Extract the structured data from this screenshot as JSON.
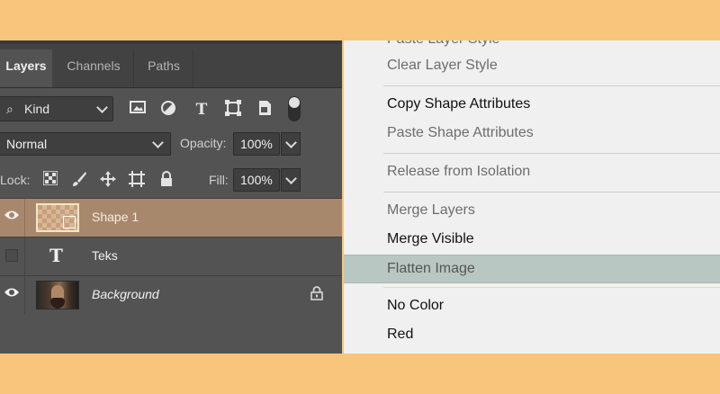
{
  "panel": {
    "tabs": [
      {
        "label": "Layers",
        "active": true
      },
      {
        "label": "Channels",
        "active": false
      },
      {
        "label": "Paths",
        "active": false
      }
    ],
    "filter": {
      "search_glyph": "⌕",
      "kind_label": "Kind"
    },
    "blend": {
      "mode": "Normal",
      "opacity_label": "Opacity:",
      "opacity_value": "100%"
    },
    "lock": {
      "label": "Lock:",
      "fill_label": "Fill:",
      "fill_value": "100%"
    },
    "layers": [
      {
        "name": "Shape 1",
        "selected": true,
        "visible": true
      },
      {
        "name": "Teks",
        "selected": false,
        "visible": false,
        "type_glyph": "T"
      },
      {
        "name": "Background",
        "selected": false,
        "visible": true,
        "locked": true
      }
    ]
  },
  "menu": {
    "items": [
      {
        "label": "Paste Layer Style",
        "enabled": false
      },
      {
        "label": "Clear Layer Style",
        "enabled": false
      },
      {
        "label": "Copy Shape Attributes",
        "enabled": true
      },
      {
        "label": "Paste Shape Attributes",
        "enabled": false
      },
      {
        "label": "Release from Isolation",
        "enabled": false
      },
      {
        "label": "Merge Layers",
        "enabled": false
      },
      {
        "label": "Merge Visible",
        "enabled": true
      },
      {
        "label": "Flatten Image",
        "enabled": true,
        "highlighted": true
      },
      {
        "label": "No Color",
        "enabled": true
      },
      {
        "label": "Red",
        "enabled": true
      }
    ]
  },
  "colors": {
    "frame": "#f8c57c",
    "panel_bg": "#535353",
    "selected_layer": "#a8886c",
    "menu_bg": "#f0f0f0",
    "menu_highlight": "#b8c7c1"
  }
}
